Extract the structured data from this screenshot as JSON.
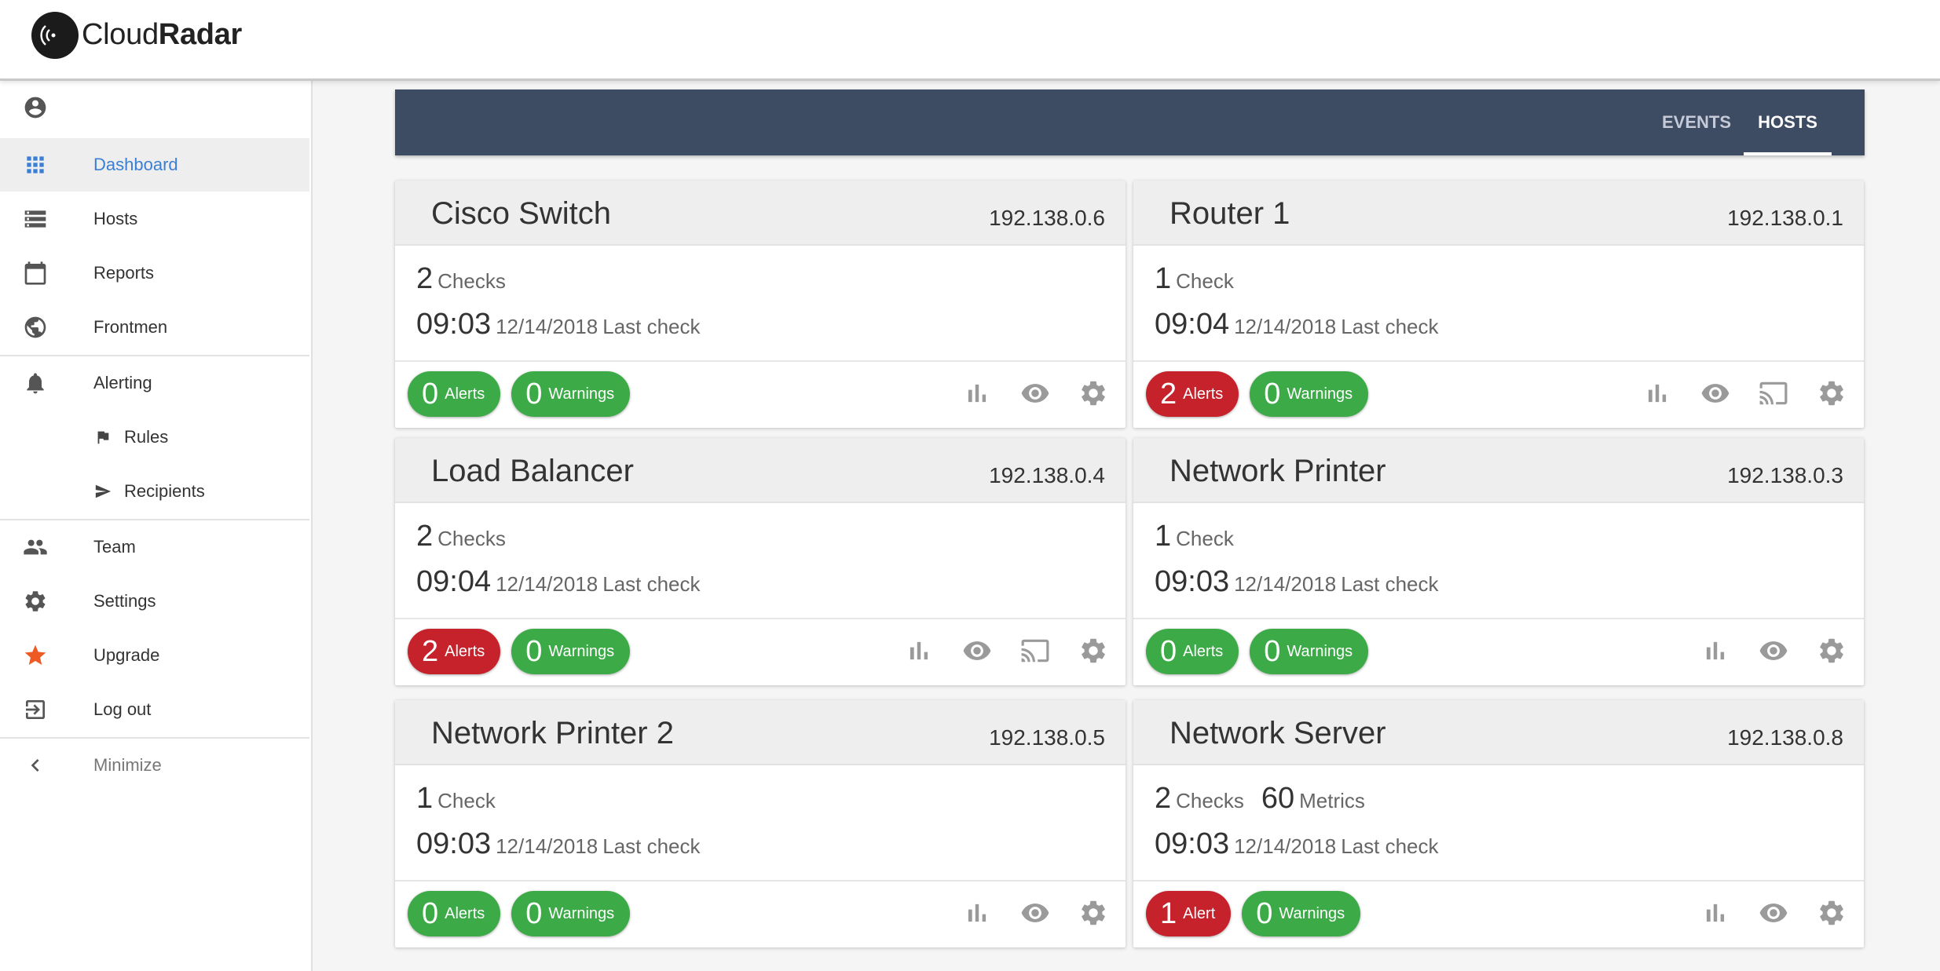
{
  "app": {
    "logo_word_light": "Cloud",
    "logo_word_bold": "Radar",
    "accent_color": "#3b7fd4",
    "header_color": "#3d4b63"
  },
  "sidebar": {
    "profile_icon": "account-circle-icon",
    "items": [
      {
        "label": "Dashboard",
        "icon": "grid-icon",
        "active": true
      },
      {
        "label": "Hosts",
        "icon": "server-list-icon"
      },
      {
        "label": "Reports",
        "icon": "calendar-icon"
      },
      {
        "label": "Frontmen",
        "icon": "globe-icon"
      },
      {
        "label": "Alerting",
        "icon": "bell-icon"
      },
      {
        "label": "Rules",
        "icon": "flag-icon"
      },
      {
        "label": "Recipients",
        "icon": "send-icon"
      },
      {
        "label": "Team",
        "icon": "people-icon"
      },
      {
        "label": "Settings",
        "icon": "gear-icon"
      },
      {
        "label": "Upgrade",
        "icon": "star-icon"
      },
      {
        "label": "Log out",
        "icon": "logout-icon"
      },
      {
        "label": "Minimize",
        "icon": "chevron-left-icon"
      }
    ]
  },
  "tabs": {
    "events": "EVENTS",
    "hosts": "HOSTS",
    "active": "HOSTS"
  },
  "hosts": [
    {
      "name": "Cisco Switch",
      "ip": "192.138.0.6",
      "checks": "2",
      "checks_label": "Checks",
      "time": "09:03",
      "date": "12/14/2018",
      "last_check_label": "Last check",
      "alerts": "0",
      "alerts_label": "Alerts",
      "alerts_color": "green",
      "warnings": "0",
      "warnings_label": "Warnings",
      "actions": [
        "bar-chart-icon",
        "eye-icon",
        "gear-icon"
      ]
    },
    {
      "name": "Router 1",
      "ip": "192.138.0.1",
      "checks": "1",
      "checks_label": "Check",
      "time": "09:04",
      "date": "12/14/2018",
      "last_check_label": "Last check",
      "alerts": "2",
      "alerts_label": "Alerts",
      "alerts_color": "red",
      "warnings": "0",
      "warnings_label": "Warnings",
      "actions": [
        "bar-chart-icon",
        "eye-icon",
        "cast-icon",
        "gear-icon"
      ]
    },
    {
      "name": "Load Balancer",
      "ip": "192.138.0.4",
      "checks": "2",
      "checks_label": "Checks",
      "time": "09:04",
      "date": "12/14/2018",
      "last_check_label": "Last check",
      "alerts": "2",
      "alerts_label": "Alerts",
      "alerts_color": "red",
      "warnings": "0",
      "warnings_label": "Warnings",
      "actions": [
        "bar-chart-icon",
        "eye-icon",
        "cast-icon",
        "gear-icon"
      ]
    },
    {
      "name": "Network Printer",
      "ip": "192.138.0.3",
      "checks": "1",
      "checks_label": "Check",
      "time": "09:03",
      "date": "12/14/2018",
      "last_check_label": "Last check",
      "alerts": "0",
      "alerts_label": "Alerts",
      "alerts_color": "green",
      "warnings": "0",
      "warnings_label": "Warnings",
      "actions": [
        "bar-chart-icon",
        "eye-icon",
        "gear-icon"
      ]
    },
    {
      "name": "Network Printer 2",
      "ip": "192.138.0.5",
      "checks": "1",
      "checks_label": "Check",
      "time": "09:03",
      "date": "12/14/2018",
      "last_check_label": "Last check",
      "alerts": "0",
      "alerts_label": "Alerts",
      "alerts_color": "green",
      "warnings": "0",
      "warnings_label": "Warnings",
      "actions": [
        "bar-chart-icon",
        "eye-icon",
        "gear-icon"
      ]
    },
    {
      "name": "Network Server",
      "ip": "192.138.0.8",
      "checks": "2",
      "checks_label": "Checks",
      "metrics": "60",
      "metrics_label": "Metrics",
      "time": "09:03",
      "date": "12/14/2018",
      "last_check_label": "Last check",
      "alerts": "1",
      "alerts_label": "Alert",
      "alerts_color": "red",
      "warnings": "0",
      "warnings_label": "Warnings",
      "actions": [
        "bar-chart-icon",
        "eye-icon",
        "gear-icon"
      ]
    }
  ]
}
